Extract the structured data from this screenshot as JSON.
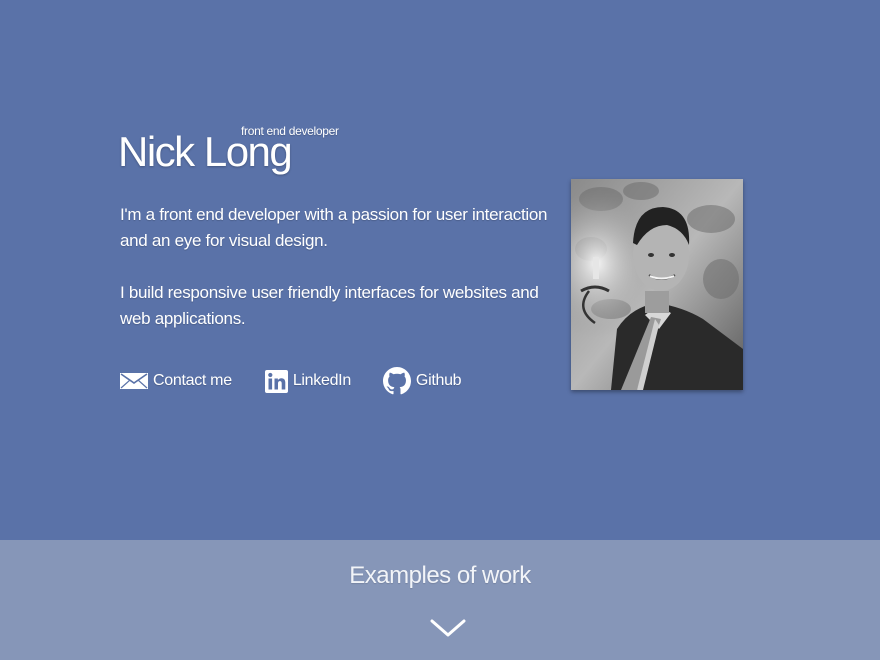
{
  "header": {
    "name": "Nick Long",
    "role": "front end developer"
  },
  "bio": {
    "paragraph_1": "I'm a front end developer with a passion for user interaction and an eye for visual design.",
    "paragraph_2": "I build responsive user friendly interfaces for websites and web applications."
  },
  "links": {
    "contact": {
      "label": "Contact me",
      "icon": "envelope-icon"
    },
    "linkedin": {
      "label": "LinkedIn",
      "icon": "linkedin-icon"
    },
    "github": {
      "label": "Github",
      "icon": "github-icon"
    }
  },
  "portrait": {
    "alt": "Portrait photo"
  },
  "footer": {
    "title": "Examples of work",
    "icon": "chevron-down-icon"
  },
  "colors": {
    "hero_background": "#5a72a8",
    "footer_background": "#8696b8",
    "text": "#ffffff"
  }
}
